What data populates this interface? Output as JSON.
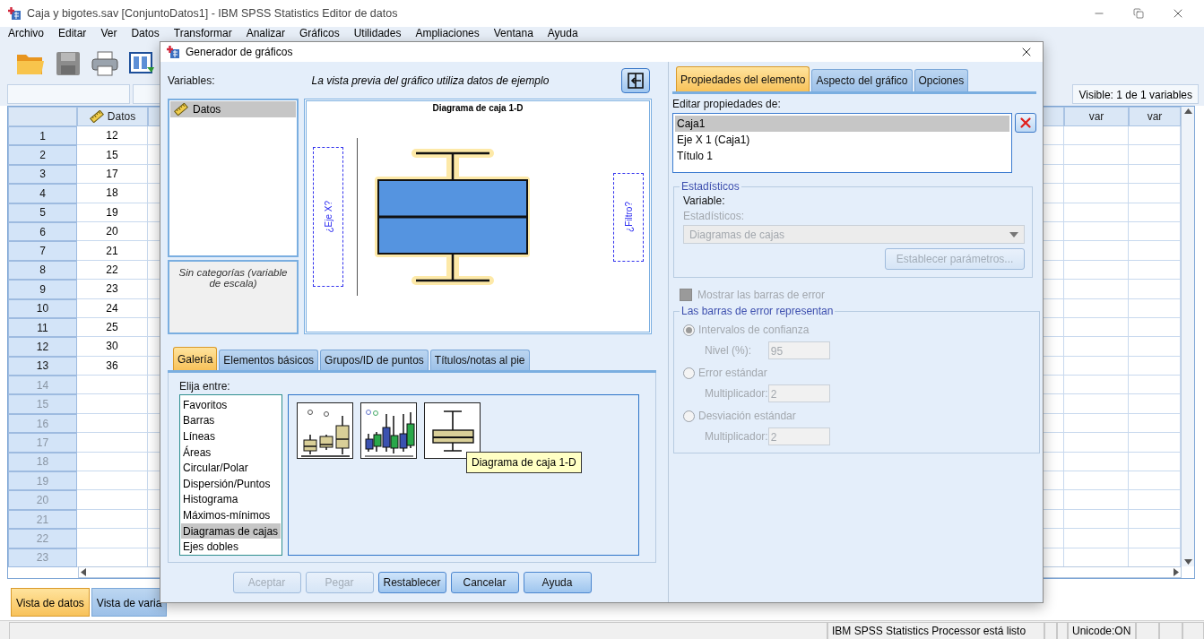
{
  "window": {
    "title": "Caja y bigotes.sav [ConjuntoDatos1] - IBM SPSS Statistics Editor de datos"
  },
  "menu": [
    "Archivo",
    "Editar",
    "Ver",
    "Datos",
    "Transformar",
    "Analizar",
    "Gráficos",
    "Utilidades",
    "Ampliaciones",
    "Ventana",
    "Ayuda"
  ],
  "data_editor": {
    "visible_info": "Visible: 1 de 1 variables",
    "columns": [
      {
        "label": "Datos",
        "kind": "scale"
      },
      {
        "label": "var",
        "kind": "empty"
      },
      {
        "label": "var",
        "kind": "empty"
      }
    ],
    "rows": [
      {
        "number": "1",
        "value": "12"
      },
      {
        "number": "2",
        "value": "15"
      },
      {
        "number": "3",
        "value": "17"
      },
      {
        "number": "4",
        "value": "18"
      },
      {
        "number": "5",
        "value": "19"
      },
      {
        "number": "6",
        "value": "20"
      },
      {
        "number": "7",
        "value": "21"
      },
      {
        "number": "8",
        "value": "22"
      },
      {
        "number": "9",
        "value": "23"
      },
      {
        "number": "10",
        "value": "24"
      },
      {
        "number": "11",
        "value": "25"
      },
      {
        "number": "12",
        "value": "30"
      },
      {
        "number": "13",
        "value": "36"
      },
      {
        "number": "14"
      },
      {
        "number": "15"
      },
      {
        "number": "16"
      },
      {
        "number": "17"
      },
      {
        "number": "18"
      },
      {
        "number": "19"
      },
      {
        "number": "20"
      },
      {
        "number": "21"
      },
      {
        "number": "22"
      },
      {
        "number": "23"
      }
    ]
  },
  "view_tabs": [
    {
      "label": "Vista de datos",
      "selected": true
    },
    {
      "label": "Vista de varia",
      "selected": false
    }
  ],
  "status_bar": {
    "message": "IBM SPSS Statistics Processor está listo",
    "encoding": "Unicode:ON"
  },
  "dialog": {
    "title": "Generador de gráficos",
    "variables_label": "Variables:",
    "preview_note": "La vista previa del gráfico utiliza datos de ejemplo",
    "variables": [
      {
        "name": "Datos",
        "selected": true
      }
    ],
    "categories_note": "Sin categorías (variable de escala)",
    "preview": {
      "title": "Diagrama de caja 1-D",
      "x_axis_zone": "¿Eje X?",
      "filter_zone": "¿Filtro?"
    },
    "tabs": [
      {
        "label": "Galería",
        "selected": true
      },
      {
        "label": "Elementos básicos",
        "selected": false
      },
      {
        "label": "Grupos/ID de puntos",
        "selected": false
      },
      {
        "label": "Títulos/notas al pie",
        "selected": false
      }
    ],
    "choose_label": "Elija entre:",
    "chart_types": [
      {
        "label": "Favoritos",
        "selected": false
      },
      {
        "label": "Barras",
        "selected": false
      },
      {
        "label": "Líneas",
        "selected": false
      },
      {
        "label": "Áreas",
        "selected": false
      },
      {
        "label": "Circular/Polar",
        "selected": false
      },
      {
        "label": "Dispersión/Puntos",
        "selected": false
      },
      {
        "label": "Histograma",
        "selected": false
      },
      {
        "label": "Máximos-mínimos",
        "selected": false
      },
      {
        "label": "Diagramas de cajas",
        "selected": true
      },
      {
        "label": "Ejes dobles",
        "selected": false
      }
    ],
    "gallery": [
      {
        "kind": "simple"
      },
      {
        "kind": "clustered"
      },
      {
        "kind": "one_d",
        "tooltip": "Diagrama de caja 1-D"
      }
    ],
    "buttons": [
      {
        "label": "Aceptar",
        "disabled": true
      },
      {
        "label": "Pegar",
        "disabled": true
      },
      {
        "label": "Restablecer",
        "disabled": false
      },
      {
        "label": "Cancelar",
        "disabled": false
      },
      {
        "label": "Ayuda",
        "disabled": false
      }
    ],
    "properties": {
      "tabs": [
        {
          "label": "Propiedades del elemento",
          "selected": true
        },
        {
          "label": "Aspecto del gráfico",
          "selected": false
        },
        {
          "label": "Opciones",
          "selected": false
        }
      ],
      "edit_label": "Editar propiedades de:",
      "elements": [
        {
          "label": "Caja1",
          "selected": true
        },
        {
          "label": "Eje X 1 (Caja1)",
          "selected": false
        },
        {
          "label": "Título 1",
          "selected": false
        }
      ],
      "statistics": {
        "legend": "Estadísticos",
        "variable_label": "Variable:",
        "statistic_label": "Estadísticos:",
        "statistic_value": "Diagramas de cajas",
        "params_button": "Establecer parámetros...",
        "disabled": true
      },
      "show_error_bars": {
        "label": "Mostrar las barras de error",
        "checked": false,
        "disabled": true
      },
      "error_bars": {
        "legend": "Las barras de error representan",
        "disabled": true,
        "options": [
          {
            "label": "Intervalos de confianza",
            "selected": true,
            "field_label": "Nivel (%):",
            "field_value": "95"
          },
          {
            "label": "Error estándar",
            "selected": false,
            "field_label": "Multiplicador:",
            "field_value": "2"
          },
          {
            "label": "Desviación estándar",
            "selected": false,
            "field_label": "Multiplicador:",
            "field_value": "2"
          }
        ]
      }
    }
  }
}
